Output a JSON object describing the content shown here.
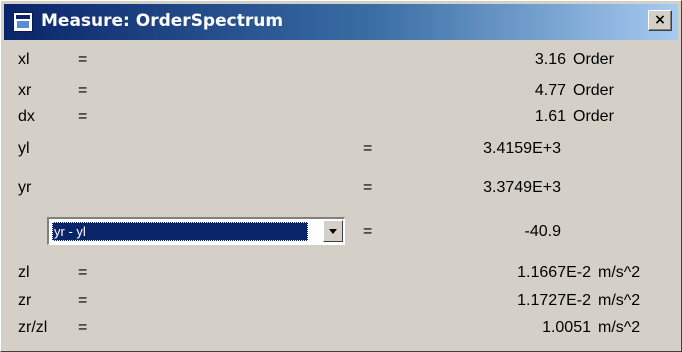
{
  "window": {
    "title": "Measure: OrderSpectrum",
    "close_label": "×"
  },
  "rows": {
    "xl": {
      "label": "xl",
      "eq": "=",
      "value": "3.16",
      "unit": "Order"
    },
    "xr": {
      "label": "xr",
      "eq": "=",
      "value": "4.77",
      "unit": "Order"
    },
    "dx": {
      "label": "dx",
      "eq": "=",
      "value": "1.61",
      "unit": "Order"
    },
    "yl": {
      "label": "yl",
      "eq": "=",
      "value": "3.4159E+3"
    },
    "yr": {
      "label": "yr",
      "eq": "=",
      "value": "3.3749E+3"
    },
    "calc": {
      "selected": "yr - yl",
      "eq": "=",
      "value": "-40.9"
    },
    "zl": {
      "label": "zl",
      "eq": "=",
      "value": "1.1667E-2",
      "unit": "m/s^2"
    },
    "zr": {
      "label": "zr",
      "eq": "=",
      "value": "1.1727E-2",
      "unit": "m/s^2"
    },
    "zrzl": {
      "label": "zr/zl",
      "eq": "=",
      "value": "1.0051",
      "unit": "m/s^2"
    }
  },
  "icons": {
    "app": "window-icon",
    "close": "close-icon",
    "dropdown": "chevron-down-icon"
  },
  "colors": {
    "titlebar_start": "#0a246a",
    "titlebar_end": "#a6caf0",
    "face": "#d4d0c8",
    "selection": "#0a246a"
  }
}
